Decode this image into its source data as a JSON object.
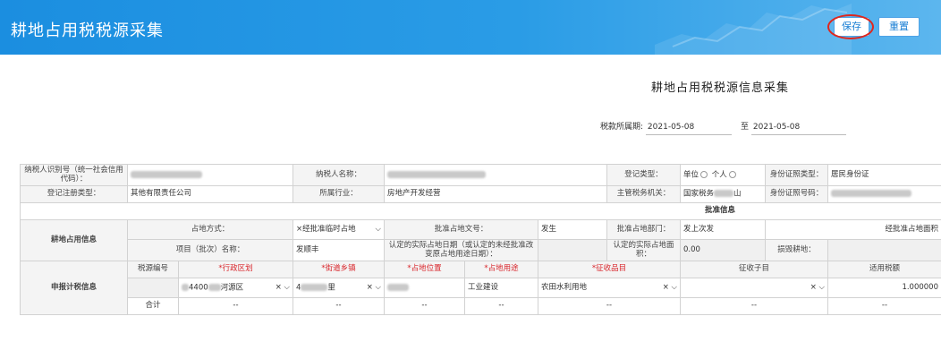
{
  "header": {
    "title": "耕地占用税税源采集",
    "save_label": "保存",
    "reset_label": "重置"
  },
  "form_title": "耕地占用税税源信息采集",
  "period": {
    "label": "税款所属期:",
    "start": "2021-05-08",
    "to_label": "至",
    "end": "2021-05-08"
  },
  "row1": {
    "taxpayer_id_label": "纳税人识别号（统一社会信用代码）：",
    "taxpayer_name_label": "纳税人名称：",
    "reg_type_label": "登记类型：",
    "reg_type_options": [
      "单位",
      "个人"
    ],
    "id_type_label": "身份证照类型：",
    "id_type_value": "居民身份证"
  },
  "row2": {
    "reg_class_label": "登记注册类型：",
    "reg_class_value": "其他有限责任公司",
    "industry_label": "所属行业：",
    "industry_value": "房地产开发经营",
    "tax_office_label": "主管税务机关：",
    "tax_office_value": "国家税务",
    "tax_office_tail": "山",
    "id_no_label": "身份证照号码："
  },
  "approval": {
    "section_label": "批准信息",
    "group_label": "耕地占用信息",
    "occupy_way_label": "占地方式：",
    "occupy_way_value": "×经批准临时占地",
    "doc_no_label": "批准占地文号：",
    "doc_no_value": "发生",
    "dept_label": "批准占地部门：",
    "dept_value": "发上次发",
    "approved_area_label": "经批准占地面积",
    "project_label": "项目（批次）名称：",
    "project_value": "发顺丰",
    "actual_date_label": "认定的实际占地日期（或认定的未经批准改变原占地用途日期）：",
    "actual_area_label": "认定的实际占地面积：",
    "actual_area_value": "0.00",
    "damaged_label": "损毁耕地："
  },
  "declare": {
    "group_label": "申报计税信息",
    "headers": [
      "税源编号",
      "*行政区划",
      "*街道乡镇",
      "*占地位置",
      "*占地用途",
      "*征收品目",
      "征收子目",
      "适用税额"
    ],
    "row": {
      "district": "4400",
      "district_suffix": "河源区",
      "street": "4",
      "street_suffix": "里",
      "usage": "工业建设",
      "item": "农田水利用地",
      "rate": "1.000000"
    },
    "total_label": "合计",
    "dash": "--"
  }
}
